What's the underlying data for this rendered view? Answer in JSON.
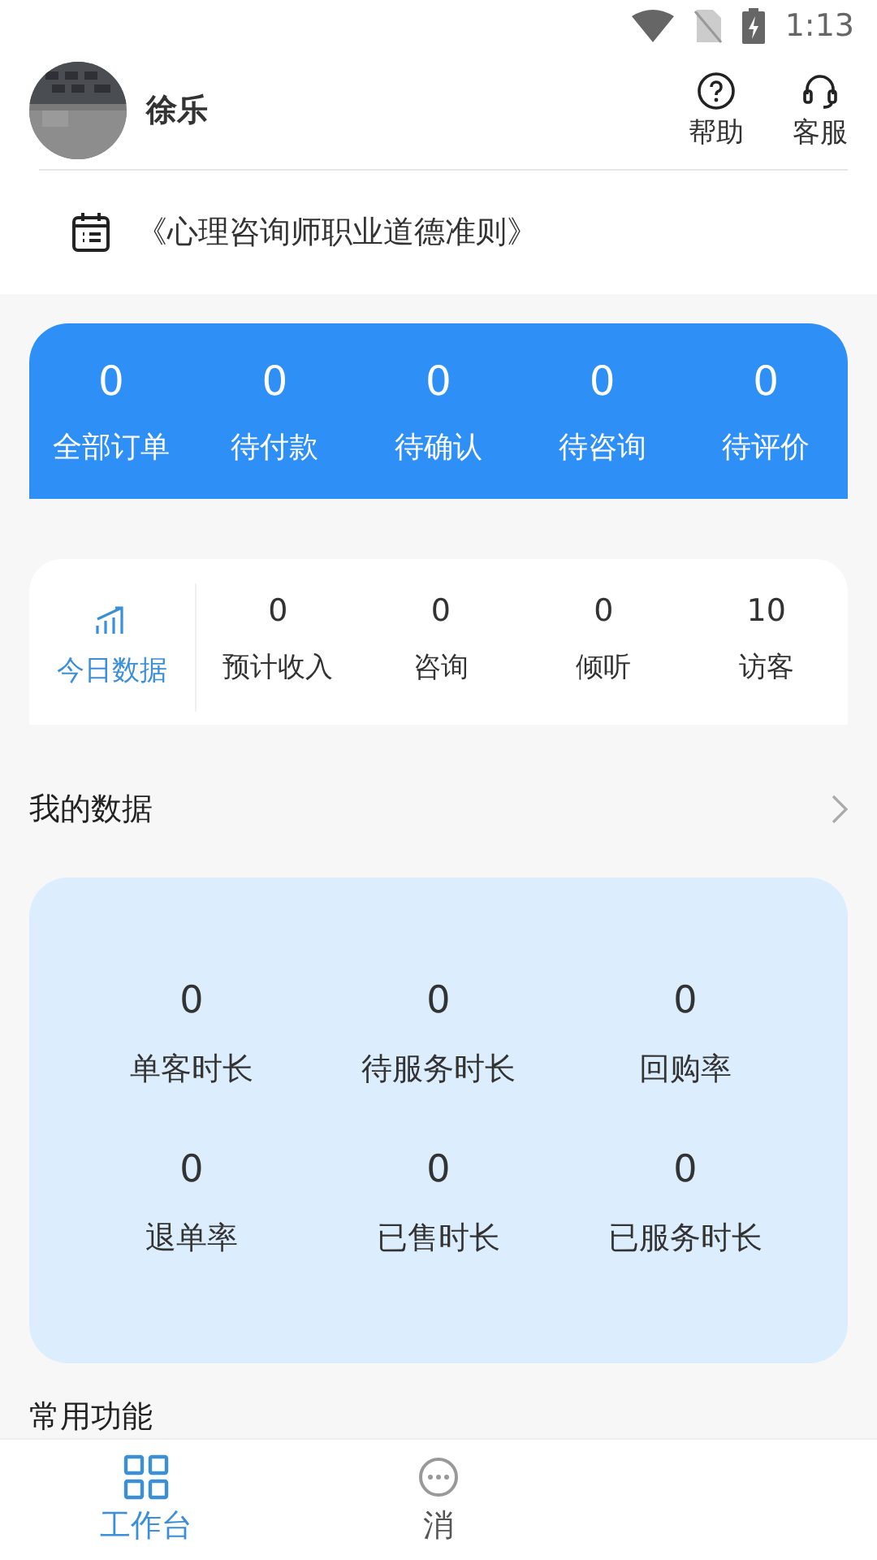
{
  "status_bar": {
    "time": "1:13"
  },
  "header": {
    "user_name": "徐乐",
    "actions": [
      {
        "label": "帮助",
        "kind": "help"
      },
      {
        "label": "客服",
        "kind": "service"
      }
    ]
  },
  "notice": {
    "text": "《心理咨询师职业道德准则》"
  },
  "order_summary": {
    "items": [
      {
        "value": "0",
        "label": "全部订单"
      },
      {
        "value": "0",
        "label": "待付款"
      },
      {
        "value": "0",
        "label": "待确认"
      },
      {
        "value": "0",
        "label": "待咨询"
      },
      {
        "value": "0",
        "label": "待评价"
      }
    ]
  },
  "today_stats": {
    "title": "今日数据",
    "items": [
      {
        "value": "0",
        "label": "预计收入"
      },
      {
        "value": "0",
        "label": "咨询"
      },
      {
        "value": "0",
        "label": "倾听"
      },
      {
        "value": "10",
        "label": "访客"
      }
    ]
  },
  "my_data": {
    "title": "我的数据",
    "items": [
      {
        "value": "0",
        "label": "单客时长"
      },
      {
        "value": "0",
        "label": "待服务时长"
      },
      {
        "value": "0",
        "label": "回购率"
      },
      {
        "value": "0",
        "label": "退单率"
      },
      {
        "value": "0",
        "label": "已售时长"
      },
      {
        "value": "0",
        "label": "已服务时长"
      }
    ]
  },
  "common_functions": {
    "title": "常用功能"
  },
  "bottom_nav": [
    {
      "label": "工作台",
      "kind": "grid",
      "selected": true
    },
    {
      "label": "消",
      "kind": "chat",
      "selected": false
    }
  ]
}
